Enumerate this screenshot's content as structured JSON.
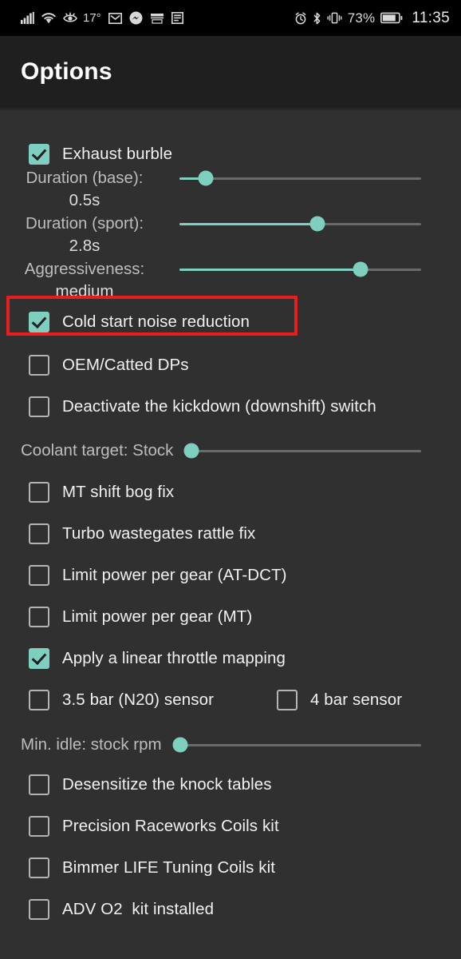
{
  "statusbar": {
    "left_icons": [
      {
        "name": "signal-bars-icon"
      },
      {
        "name": "wifi-icon"
      },
      {
        "name": "eye-comfort-icon"
      },
      {
        "name": "gmail-icon"
      },
      {
        "name": "messenger-icon"
      },
      {
        "name": "shopping-app-icon"
      },
      {
        "name": "news-app-icon"
      }
    ],
    "temperature": "17°",
    "right_icons": [
      {
        "name": "alarm-icon"
      },
      {
        "name": "bluetooth-icon"
      },
      {
        "name": "vibrate-icon"
      }
    ],
    "battery_percent": "73%",
    "battery_icon": "battery-icon",
    "clock": "11:35"
  },
  "header": {
    "title": "Options"
  },
  "colors": {
    "accent": "#7ecfc0",
    "highlight": "#e81e1e",
    "background": "#303030",
    "header_background": "#1f1f1f",
    "track": "#6a6a6a"
  },
  "options": [
    {
      "type": "checkbox",
      "label": "Exhaust burble",
      "checked": true,
      "highlighted": false
    },
    {
      "type": "slider_stacked",
      "label": "Duration (base):",
      "value": "0.5s",
      "percent": 11
    },
    {
      "type": "slider_stacked",
      "label": "Duration (sport):",
      "value": "2.8s",
      "percent": 57
    },
    {
      "type": "slider_stacked",
      "label": "Aggressiveness:",
      "value": "medium",
      "percent": 75
    },
    {
      "type": "checkbox",
      "label": "Cold start noise reduction",
      "checked": true,
      "highlighted": true
    },
    {
      "type": "checkbox",
      "label": "OEM/Catted DPs",
      "checked": false,
      "highlighted": false
    },
    {
      "type": "checkbox",
      "label": "Deactivate the kickdown (downshift) switch",
      "checked": false,
      "highlighted": false
    },
    {
      "type": "slider_inline",
      "label": "Coolant target: Stock",
      "percent": 3
    },
    {
      "type": "checkbox",
      "label": "MT shift bog fix",
      "checked": false,
      "highlighted": false
    },
    {
      "type": "checkbox",
      "label": "Turbo wastegates rattle fix",
      "checked": false,
      "highlighted": false
    },
    {
      "type": "checkbox",
      "label": "Limit power per gear (AT-DCT)",
      "checked": false,
      "highlighted": false
    },
    {
      "type": "checkbox",
      "label": "Limit power per gear (MT)",
      "checked": false,
      "highlighted": false
    },
    {
      "type": "checkbox",
      "label": "Apply a linear throttle mapping",
      "checked": true,
      "highlighted": false
    },
    {
      "type": "checkbox_pair",
      "label": "3.5 bar (N20) sensor",
      "checked": false,
      "label2": "4 bar sensor",
      "checked2": false
    },
    {
      "type": "slider_inline",
      "label": "Min. idle: stock rpm",
      "percent": 3
    },
    {
      "type": "checkbox",
      "label": "Desensitize the knock tables",
      "checked": false,
      "highlighted": false
    },
    {
      "type": "checkbox",
      "label": "Precision Raceworks Coils kit",
      "checked": false,
      "highlighted": false
    },
    {
      "type": "checkbox",
      "label": "Bimmer LIFE Tuning Coils kit",
      "checked": false,
      "highlighted": false
    },
    {
      "type": "checkbox",
      "label": "ADV O2  kit installed",
      "checked": false,
      "highlighted": false
    }
  ]
}
